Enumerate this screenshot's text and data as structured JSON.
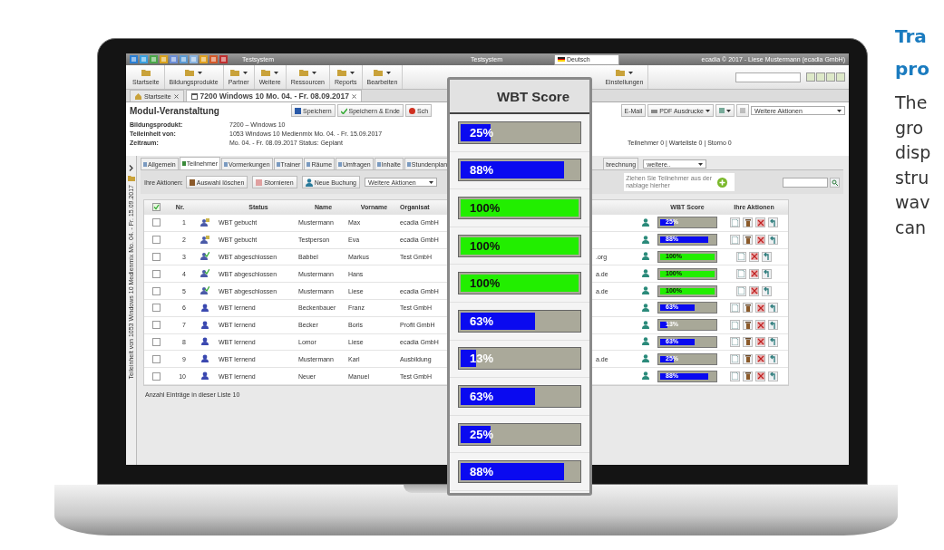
{
  "topbar": {
    "title": "Testsystem",
    "center_title": "Testsystem",
    "language": "Deutsch",
    "user": "ecadia © 2017 - Liese Mustermann (ecadia GmbH)"
  },
  "menu": [
    {
      "label": "Startseite",
      "dropdown": false
    },
    {
      "label": "Bildungsprodukte",
      "dropdown": true
    },
    {
      "label": "Partner",
      "dropdown": true
    },
    {
      "label": "Weitere",
      "dropdown": true
    },
    {
      "label": "Ressourcen",
      "dropdown": true
    },
    {
      "label": "Reports",
      "dropdown": true
    },
    {
      "label": "Bearbeiten",
      "dropdown": true
    },
    {
      "label": "Einstellungen",
      "dropdown": true
    }
  ],
  "doc_tabs": [
    {
      "label": "Startseite",
      "selected": false
    },
    {
      "label": "7200 Windows 10 Mo. 04. - Fr. 08.09.2017",
      "selected": true
    }
  ],
  "page_title": "Modul-Veranstaltung",
  "toolbar_left": [
    "Speichern",
    "Speichern & Ende",
    "Sch"
  ],
  "toolbar_right": {
    "email": "E-Mail",
    "pdf": "PDF Ausdrucke",
    "more": "Weitere Aktionen"
  },
  "info": [
    {
      "label": "Bildungsprodukt:",
      "value": "7200 – Windows 10"
    },
    {
      "label": "Teileinheit von:",
      "value": "1053 Windows 10 Medienmix Mo. 04. - Fr. 15.09.2017"
    },
    {
      "label": "Zeitraum:",
      "value": "Mo. 04. - Fr. 08.09.2017  Status: Geplant"
    }
  ],
  "counts": "Teilnehmer 0 | Warteliste 0 | Storno 0",
  "side_caption": "Teileinheit von 1053 Windows 10 Medienmix Mo. 04. - Fr. 15.09.2017",
  "sub_tabs": [
    {
      "label": "Allgemein",
      "selected": false
    },
    {
      "label": "Teilnehmer",
      "selected": true
    },
    {
      "label": "Vormerkungen",
      "selected": false
    },
    {
      "label": "Trainer",
      "selected": false
    },
    {
      "label": "Räume",
      "selected": false
    },
    {
      "label": "Umfragen",
      "selected": false
    },
    {
      "label": "Inhalte",
      "selected": false
    },
    {
      "label": "Stundenplan",
      "selected": false
    }
  ],
  "sub_tabs_right": {
    "tab": "brechnung",
    "select": "weitere.."
  },
  "actions": {
    "label": "Ihre Aktionen:",
    "buttons": [
      "Auswahl löschen",
      "Stornieren",
      "Neue Buchung"
    ],
    "more": "Weitere Aktionen",
    "hint": [
      "Ziehen Sie Teilnehmer aus der",
      "nablage hierher"
    ]
  },
  "table": {
    "all_checked": true,
    "columns": [
      "Nr.",
      "Status",
      "Name",
      "Vorname",
      "Organisat",
      "WBT Score",
      "Ihre Aktionen"
    ],
    "rows": [
      {
        "checked": false,
        "nr": "1",
        "kind": "booked",
        "status": "WBT gebucht",
        "name": "Mustermann",
        "vorname": "Max",
        "organisation": "ecadia GmbH",
        "score": {
          "label": "25%",
          "level": 0.25,
          "color": "#0a0af0"
        },
        "deletable": true
      },
      {
        "checked": false,
        "nr": "2",
        "kind": "booked",
        "status": "WBT gebucht",
        "name": "Testperson",
        "vorname": "Eva",
        "organisation": "ecadia GmbH",
        "score": {
          "label": "88%",
          "level": 0.88,
          "color": "#0a0af0"
        },
        "deletable": true
      },
      {
        "checked": false,
        "nr": "3",
        "kind": "completed",
        "status": "WBT abgeschlossen",
        "name": "Babbel",
        "vorname": "Markus",
        "organisation": "Test GmbH",
        "email": ".org",
        "score": {
          "label": "100%",
          "level": 1,
          "color": "#22ee00"
        },
        "deletable": false
      },
      {
        "checked": false,
        "nr": "4",
        "kind": "completed",
        "status": "WBT abgeschlossen",
        "name": "Mustermann",
        "vorname": "Hans",
        "email": "a.de",
        "score": {
          "label": "100%",
          "level": 1,
          "color": "#22ee00"
        },
        "deletable": false
      },
      {
        "checked": false,
        "nr": "5",
        "kind": "completed",
        "status": "WBT abgeschlossen",
        "name": "Mustermann",
        "vorname": "Liese",
        "organisation": "ecadia GmbH",
        "email": "a.de",
        "score": {
          "label": "100%",
          "level": 1,
          "color": "#22ee00"
        },
        "deletable": false
      },
      {
        "checked": false,
        "nr": "6",
        "kind": "learning",
        "status": "WBT lernend",
        "name": "Beckenbauer",
        "vorname": "Franz",
        "organisation": "Test GmbH",
        "score": {
          "label": "63%",
          "level": 0.63,
          "color": "#0a0af0"
        },
        "deletable": true
      },
      {
        "checked": false,
        "nr": "7",
        "kind": "learning",
        "status": "WBT lernend",
        "name": "Becker",
        "vorname": "Boris",
        "organisation": "Profit GmbH",
        "score": {
          "label": "13%",
          "level": 0.13,
          "color": "#0a0af0"
        },
        "deletable": true
      },
      {
        "checked": false,
        "nr": "8",
        "kind": "learning",
        "status": "WBT lernend",
        "name": "Lomor",
        "vorname": "Liese",
        "organisation": "ecadia GmbH",
        "score": {
          "label": "63%",
          "level": 0.63,
          "color": "#0a0af0"
        },
        "deletable": true
      },
      {
        "checked": false,
        "nr": "9",
        "kind": "learning",
        "status": "WBT lernend",
        "name": "Mustermann",
        "vorname": "Karl",
        "organisation": "Ausbildung",
        "email": "a.de",
        "score": {
          "label": "25%",
          "level": 0.25,
          "color": "#0a0af0"
        },
        "deletable": true
      },
      {
        "checked": false,
        "nr": "10",
        "kind": "learning",
        "status": "WBT lernend",
        "name": "Neuer",
        "vorname": "Manuel",
        "organisation": "Test GmbH",
        "score": {
          "label": "88%",
          "level": 0.88,
          "color": "#0a0af0"
        },
        "deletable": true
      }
    ],
    "footer": "Anzahl Einträge in dieser Liste 10"
  },
  "zoom_overlay": {
    "title": "WBT Score",
    "bars": [
      {
        "label": "25%",
        "level": 0.25,
        "color": "#0a0af0"
      },
      {
        "label": "88%",
        "level": 0.88,
        "color": "#0a0af0"
      },
      {
        "label": "100%",
        "level": 1,
        "color": "#22ee00"
      },
      {
        "label": "100%",
        "level": 1,
        "color": "#22ee00"
      },
      {
        "label": "100%",
        "level": 1,
        "color": "#22ee00"
      },
      {
        "label": "63%",
        "level": 0.63,
        "color": "#0a0af0"
      },
      {
        "label": "13%",
        "level": 0.13,
        "color": "#0a0af0"
      },
      {
        "label": "63%",
        "level": 0.63,
        "color": "#0a0af0"
      },
      {
        "label": "25%",
        "level": 0.25,
        "color": "#0a0af0"
      },
      {
        "label": "88%",
        "level": 0.88,
        "color": "#0a0af0"
      }
    ]
  },
  "side_text": {
    "heading": [
      "Tra",
      "pro"
    ],
    "body": [
      "The",
      "gro",
      "disp",
      "stru",
      "wav",
      "can"
    ]
  }
}
